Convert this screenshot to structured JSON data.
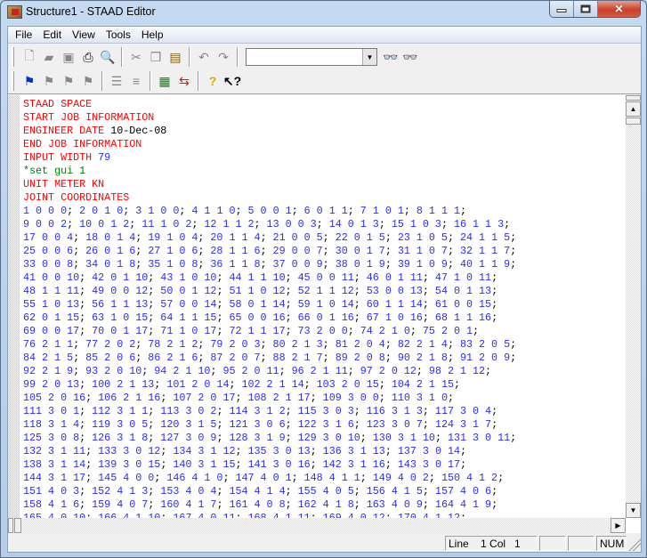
{
  "window": {
    "title": "Structure1 - STAAD Editor"
  },
  "menu": [
    "File",
    "Edit",
    "View",
    "Tools",
    "Help"
  ],
  "toolbar": {
    "row1": [
      "new-file",
      "open-file",
      "save",
      "print",
      "print-preview",
      "|",
      "cut",
      "copy",
      "paste",
      "|",
      "undo",
      "redo",
      "|",
      "combo",
      "find",
      "find-next"
    ],
    "row2": [
      "set-bookmark",
      "next-bookmark",
      "previous-bookmark",
      "clear-bookmarks",
      "|",
      "indent",
      "outdent",
      "|",
      "spreadsheet",
      "swap",
      "|",
      "help",
      "context-help"
    ],
    "search_combo_value": ""
  },
  "editor": {
    "header_lines": [
      [
        {
          "t": "STAAD SPACE",
          "c": "kw"
        }
      ],
      [
        {
          "t": "START JOB INFORMATION",
          "c": "kw"
        }
      ],
      [
        {
          "t": "ENGINEER DATE",
          "c": "kw"
        },
        {
          "t": " 10-Dec-08",
          "c": "plain"
        }
      ],
      [
        {
          "t": "END JOB INFORMATION",
          "c": "kw"
        }
      ],
      [
        {
          "t": "INPUT WIDTH",
          "c": "kw"
        },
        {
          "t": " 79",
          "c": "num"
        }
      ],
      [
        {
          "t": "*set gui 1",
          "c": "cmt"
        }
      ],
      [
        {
          "t": "UNIT METER KN",
          "c": "kw"
        }
      ],
      [
        {
          "t": "JOINT COORDINATES",
          "c": "kw"
        }
      ]
    ],
    "joint_lines": [
      "1 0 0 0; 2 0 1 0; 3 1 0 0; 4 1 1 0; 5 0 0 1; 6 0 1 1; 7 1 0 1; 8 1 1 1;",
      "9 0 0 2; 10 0 1 2; 11 1 0 2; 12 1 1 2; 13 0 0 3; 14 0 1 3; 15 1 0 3; 16 1 1 3;",
      "17 0 0 4; 18 0 1 4; 19 1 0 4; 20 1 1 4; 21 0 0 5; 22 0 1 5; 23 1 0 5; 24 1 1 5;",
      "25 0 0 6; 26 0 1 6; 27 1 0 6; 28 1 1 6; 29 0 0 7; 30 0 1 7; 31 1 0 7; 32 1 1 7;",
      "33 0 0 8; 34 0 1 8; 35 1 0 8; 36 1 1 8; 37 0 0 9; 38 0 1 9; 39 1 0 9; 40 1 1 9;",
      "41 0 0 10; 42 0 1 10; 43 1 0 10; 44 1 1 10; 45 0 0 11; 46 0 1 11; 47 1 0 11;",
      "48 1 1 11; 49 0 0 12; 50 0 1 12; 51 1 0 12; 52 1 1 12; 53 0 0 13; 54 0 1 13;",
      "55 1 0 13; 56 1 1 13; 57 0 0 14; 58 0 1 14; 59 1 0 14; 60 1 1 14; 61 0 0 15;",
      "62 0 1 15; 63 1 0 15; 64 1 1 15; 65 0 0 16; 66 0 1 16; 67 1 0 16; 68 1 1 16;",
      "69 0 0 17; 70 0 1 17; 71 1 0 17; 72 1 1 17; 73 2 0 0; 74 2 1 0; 75 2 0 1;",
      "76 2 1 1; 77 2 0 2; 78 2 1 2; 79 2 0 3; 80 2 1 3; 81 2 0 4; 82 2 1 4; 83 2 0 5;",
      "84 2 1 5; 85 2 0 6; 86 2 1 6; 87 2 0 7; 88 2 1 7; 89 2 0 8; 90 2 1 8; 91 2 0 9;",
      "92 2 1 9; 93 2 0 10; 94 2 1 10; 95 2 0 11; 96 2 1 11; 97 2 0 12; 98 2 1 12;",
      "99 2 0 13; 100 2 1 13; 101 2 0 14; 102 2 1 14; 103 2 0 15; 104 2 1 15;",
      "105 2 0 16; 106 2 1 16; 107 2 0 17; 108 2 1 17; 109 3 0 0; 110 3 1 0;",
      "111 3 0 1; 112 3 1 1; 113 3 0 2; 114 3 1 2; 115 3 0 3; 116 3 1 3; 117 3 0 4;",
      "118 3 1 4; 119 3 0 5; 120 3 1 5; 121 3 0 6; 122 3 1 6; 123 3 0 7; 124 3 1 7;",
      "125 3 0 8; 126 3 1 8; 127 3 0 9; 128 3 1 9; 129 3 0 10; 130 3 1 10; 131 3 0 11;",
      "132 3 1 11; 133 3 0 12; 134 3 1 12; 135 3 0 13; 136 3 1 13; 137 3 0 14;",
      "138 3 1 14; 139 3 0 15; 140 3 1 15; 141 3 0 16; 142 3 1 16; 143 3 0 17;",
      "144 3 1 17; 145 4 0 0; 146 4 1 0; 147 4 0 1; 148 4 1 1; 149 4 0 2; 150 4 1 2;",
      "151 4 0 3; 152 4 1 3; 153 4 0 4; 154 4 1 4; 155 4 0 5; 156 4 1 5; 157 4 0 6;",
      "158 4 1 6; 159 4 0 7; 160 4 1 7; 161 4 0 8; 162 4 1 8; 163 4 0 9; 164 4 1 9;",
      "165 4 0 10; 166 4 1 10; 167 4 0 11; 168 4 1 11; 169 4 0 12; 170 4 1 12;"
    ]
  },
  "status": {
    "position": "Line    1 Col   1",
    "panel2": "",
    "panel3": "",
    "num": "NUM"
  }
}
